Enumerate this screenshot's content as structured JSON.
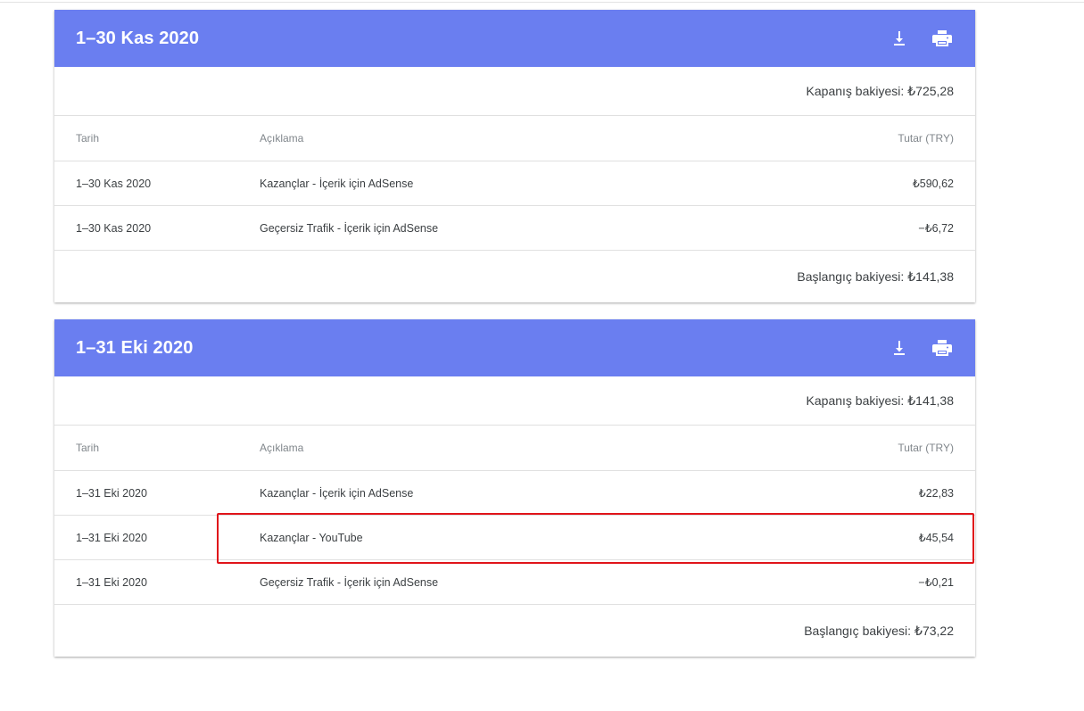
{
  "statements": [
    {
      "title": "1–30 Kas 2020",
      "closing_label": "Kapanış bakiyesi:",
      "closing_value": "₺725,28",
      "headers": {
        "date": "Tarih",
        "desc": "Açıklama",
        "amount": "Tutar (TRY)"
      },
      "rows": [
        {
          "date": "1–30 Kas 2020",
          "desc": "Kazançlar - İçerik için AdSense",
          "amount": "₺590,62"
        },
        {
          "date": "1–30 Kas 2020",
          "desc": "Geçersiz Trafik - İçerik için AdSense",
          "amount": "−₺6,72"
        }
      ],
      "opening_label": "Başlangıç bakiyesi:",
      "opening_value": "₺141,38"
    },
    {
      "title": "1–31 Eki 2020",
      "closing_label": "Kapanış bakiyesi:",
      "closing_value": "₺141,38",
      "headers": {
        "date": "Tarih",
        "desc": "Açıklama",
        "amount": "Tutar (TRY)"
      },
      "rows": [
        {
          "date": "1–31 Eki 2020",
          "desc": "Kazançlar - İçerik için AdSense",
          "amount": "₺22,83"
        },
        {
          "date": "1–31 Eki 2020",
          "desc": "Kazançlar - YouTube",
          "amount": "₺45,54"
        },
        {
          "date": "1–31 Eki 2020",
          "desc": "Geçersiz Trafik - İçerik için AdSense",
          "amount": "−₺0,21"
        }
      ],
      "opening_label": "Başlangıç bakiyesi:",
      "opening_value": "₺73,22"
    }
  ],
  "icons": {
    "download": "download-icon",
    "print": "print-icon"
  },
  "colors": {
    "header_bg": "#6a7ef0",
    "highlight": "#e0141a"
  }
}
